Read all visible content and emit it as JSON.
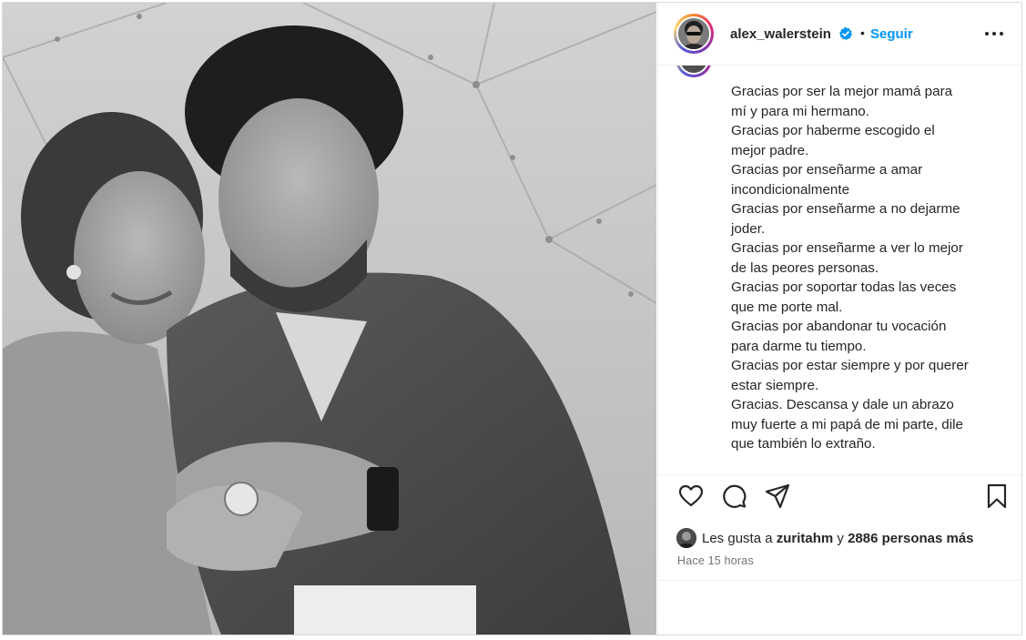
{
  "post": {
    "username": "alex_walerstein",
    "follow_label": "Seguir",
    "separator": "•",
    "caption_lines": [
      "Gracias por ser la mejor mamá para",
      "mí y para mi hermano.",
      "Gracias por haberme escogido el",
      "mejor padre.",
      "Gracias por enseñarme a amar",
      "incondicionalmente",
      "Gracias por enseñarme a no dejarme",
      "joder.",
      "Gracias por enseñarme a ver lo mejor",
      "de las peores personas.",
      "Gracias por soportar todas las veces",
      "que me porte mal.",
      "Gracias por abandonar tu vocación",
      "para darme tu tiempo.",
      "Gracias por estar siempre y por querer",
      "estar siempre.",
      "Gracias. Descansa y dale un abrazo",
      "muy fuerte a mi papá de mi parte, dile",
      "que también lo extraño."
    ],
    "likes_prefix": "Les gusta a",
    "likes_user": "zuritahm",
    "likes_joiner": "y",
    "likes_rest": "2886 personas más",
    "timestamp": "Hace 15 horas"
  },
  "icons": {
    "verified": "verified-badge-icon",
    "more": "more-options-icon",
    "like": "heart-icon",
    "comment": "comment-icon",
    "share": "send-icon",
    "save": "bookmark-icon"
  },
  "colors": {
    "link": "#0095f6",
    "text": "#262626",
    "muted": "#737373",
    "border": "#dbdbdb"
  }
}
